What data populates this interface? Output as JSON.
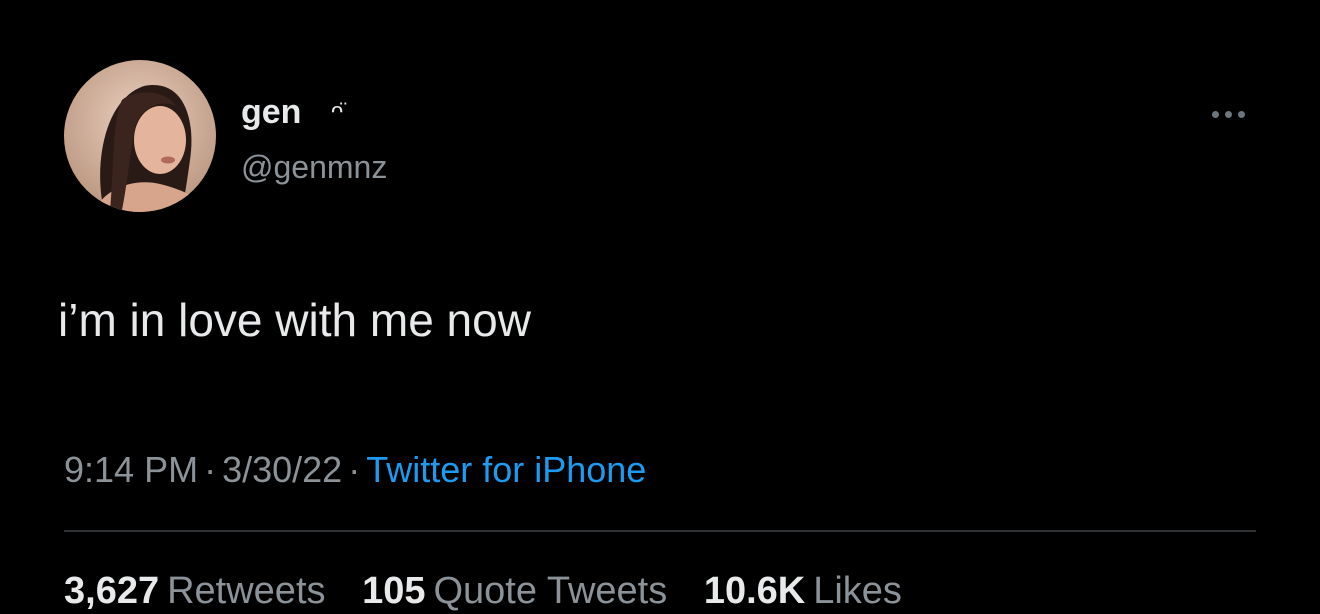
{
  "tweet": {
    "author": {
      "display_name": "gen",
      "name_emoji": "ᴖ̈",
      "handle": "@genmnz"
    },
    "text": "i’m in love with me now",
    "meta": {
      "time": "9:14 PM",
      "separator": "·",
      "date": "3/30/22",
      "source": "Twitter for iPhone"
    },
    "stats": {
      "retweets_count": "3,627",
      "retweets_label": "Retweets",
      "quotes_count": "105",
      "quotes_label": "Quote Tweets",
      "likes_count": "10.6K",
      "likes_label": "Likes"
    },
    "more_icon": "more-horizontal-icon"
  },
  "colors": {
    "background": "#000000",
    "primary_text": "#e7e9ea",
    "secondary_text": "#8b9298",
    "link": "#1d9bf0",
    "divider": "#2f3336"
  }
}
